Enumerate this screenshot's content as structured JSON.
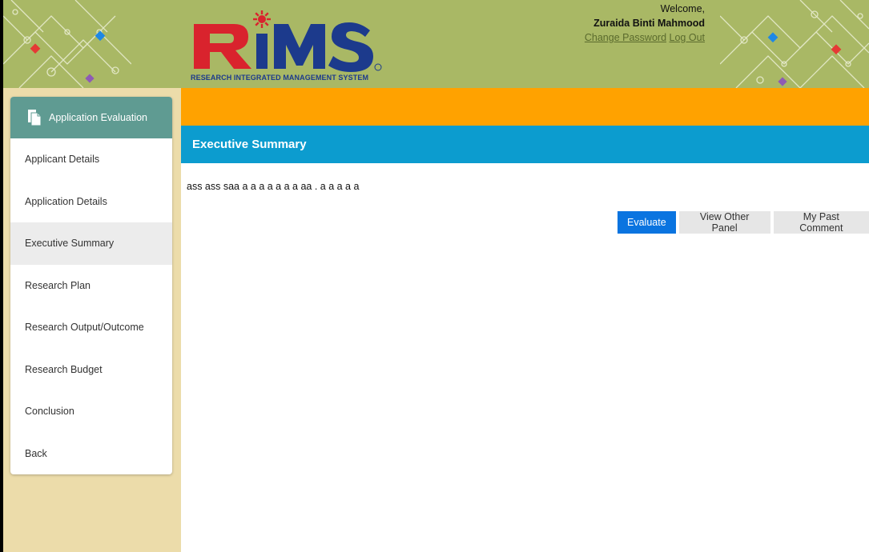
{
  "header": {
    "logo_text": "RiMS",
    "logo_tagline": "RESEARCH INTEGRATED MANAGEMENT SYSTEM",
    "welcome": "Welcome,",
    "user_name": "Zuraida Binti Mahmood",
    "change_password": "Change Password",
    "logout": "Log Out"
  },
  "sidebar": {
    "title": "Application Evaluation",
    "items": [
      {
        "label": "Applicant Details"
      },
      {
        "label": "Application Details"
      },
      {
        "label": "Executive Summary",
        "active": true
      },
      {
        "label": "Research Plan"
      },
      {
        "label": "Research Output/Outcome"
      },
      {
        "label": "Research Budget"
      },
      {
        "label": "Conclusion"
      },
      {
        "label": "Back"
      }
    ]
  },
  "main": {
    "section_title": "Executive Summary",
    "body_text": "ass ass saa a a a a a a a aa . a a a a a",
    "buttons": {
      "evaluate": "Evaluate",
      "view_other_panel": "View Other Panel",
      "my_past_comment": "My Past Comment"
    }
  },
  "colors": {
    "header_bg": "#a9b865",
    "sidebar_bg": "#ecdcaa",
    "sidebar_head": "#5f9b92",
    "orange_bar": "#ffa200",
    "blue_bar": "#0c9ccf",
    "primary_button": "#0a74e0"
  }
}
